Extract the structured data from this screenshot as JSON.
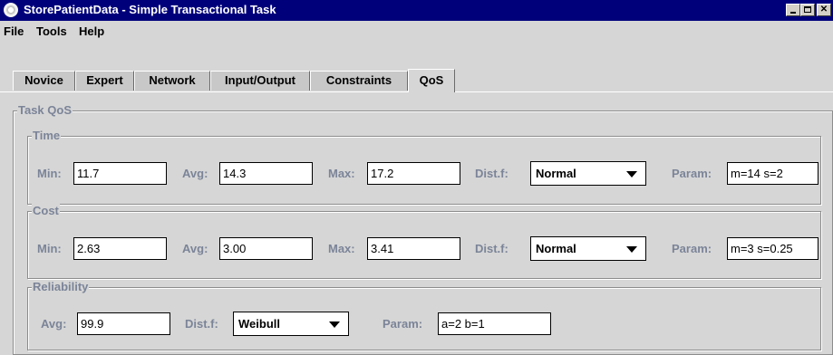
{
  "window": {
    "title": "StorePatientData - Simple Transactional Task"
  },
  "menu": {
    "file": "File",
    "tools": "Tools",
    "help": "Help"
  },
  "tabs": [
    {
      "label": "Novice"
    },
    {
      "label": "Expert"
    },
    {
      "label": "Network"
    },
    {
      "label": "Input/Output"
    },
    {
      "label": "Constraints"
    },
    {
      "label": "QoS"
    }
  ],
  "qos": {
    "title": "Task QoS",
    "time": {
      "title": "Time",
      "min_label": "Min:",
      "min": "11.7",
      "avg_label": "Avg:",
      "avg": "14.3",
      "max_label": "Max:",
      "max": "17.2",
      "dist_label": "Dist.f:",
      "dist": "Normal",
      "param_label": "Param:",
      "param": "m=14 s=2"
    },
    "cost": {
      "title": "Cost",
      "min_label": "Min:",
      "min": "2.63",
      "avg_label": "Avg:",
      "avg": "3.00",
      "max_label": "Max:",
      "max": "3.41",
      "dist_label": "Dist.f:",
      "dist": "Normal",
      "param_label": "Param:",
      "param": "m=3 s=0.25"
    },
    "reliability": {
      "title": "Reliability",
      "avg_label": "Avg:",
      "avg": "99.9",
      "dist_label": "Dist.f:",
      "dist": "Weibull",
      "param_label": "Param:",
      "param": "a=2 b=1"
    }
  }
}
